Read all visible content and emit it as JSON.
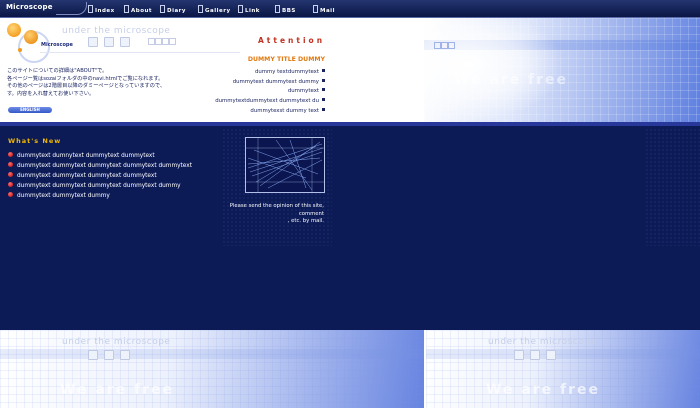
{
  "nav": {
    "brand": "Microscope",
    "items": [
      {
        "label": "Index"
      },
      {
        "label": "About"
      },
      {
        "label": "Diary"
      },
      {
        "label": "Gallery"
      },
      {
        "label": "Link"
      },
      {
        "label": "BBS"
      },
      {
        "label": "Mail"
      }
    ]
  },
  "header": {
    "watermark": "under the microscope",
    "site_title": "Microscope",
    "attention": "Attention",
    "intro_lines": [
      "このサイトについての詳細は\"ABOUT\"で。",
      "各ページー覧はsozaiフォルダの中のnavi.htmlでご覧になれます。",
      "その他のページは2階層目以降のダミーページとなっていますので、",
      "す。内容を入れ替えてお使い下さい。"
    ],
    "english_button": "ENGLISH",
    "we_are_free": "We are free",
    "dummy_title": "DUMMY TITLE DUMMY",
    "dummy_lines": [
      "dummy textdummytext",
      "dummytext dummytext dummy",
      "dummytext",
      "dummytextdummytext dummytext du",
      "dummytexst dummy text"
    ]
  },
  "whats_new": {
    "title": "What's New",
    "items": [
      "dummytext dumnytext dummytext dummytext",
      "dummytext dummytext dummytext dummytext dummytext",
      "dummytext dummytext dummytext dummytext",
      "dummytext dummytext dummytext dummytext dummy",
      "dummytext dummytext dummy"
    ]
  },
  "opinion": {
    "lines": [
      "Please send the opinion of this site,",
      "comment",
      ", etc. by mail."
    ]
  },
  "colors": {
    "navy": "#0c1a56",
    "accent_orange": "#e07a10",
    "attention_red": "#c0311f",
    "whats_new_yellow": "#f0b800"
  }
}
